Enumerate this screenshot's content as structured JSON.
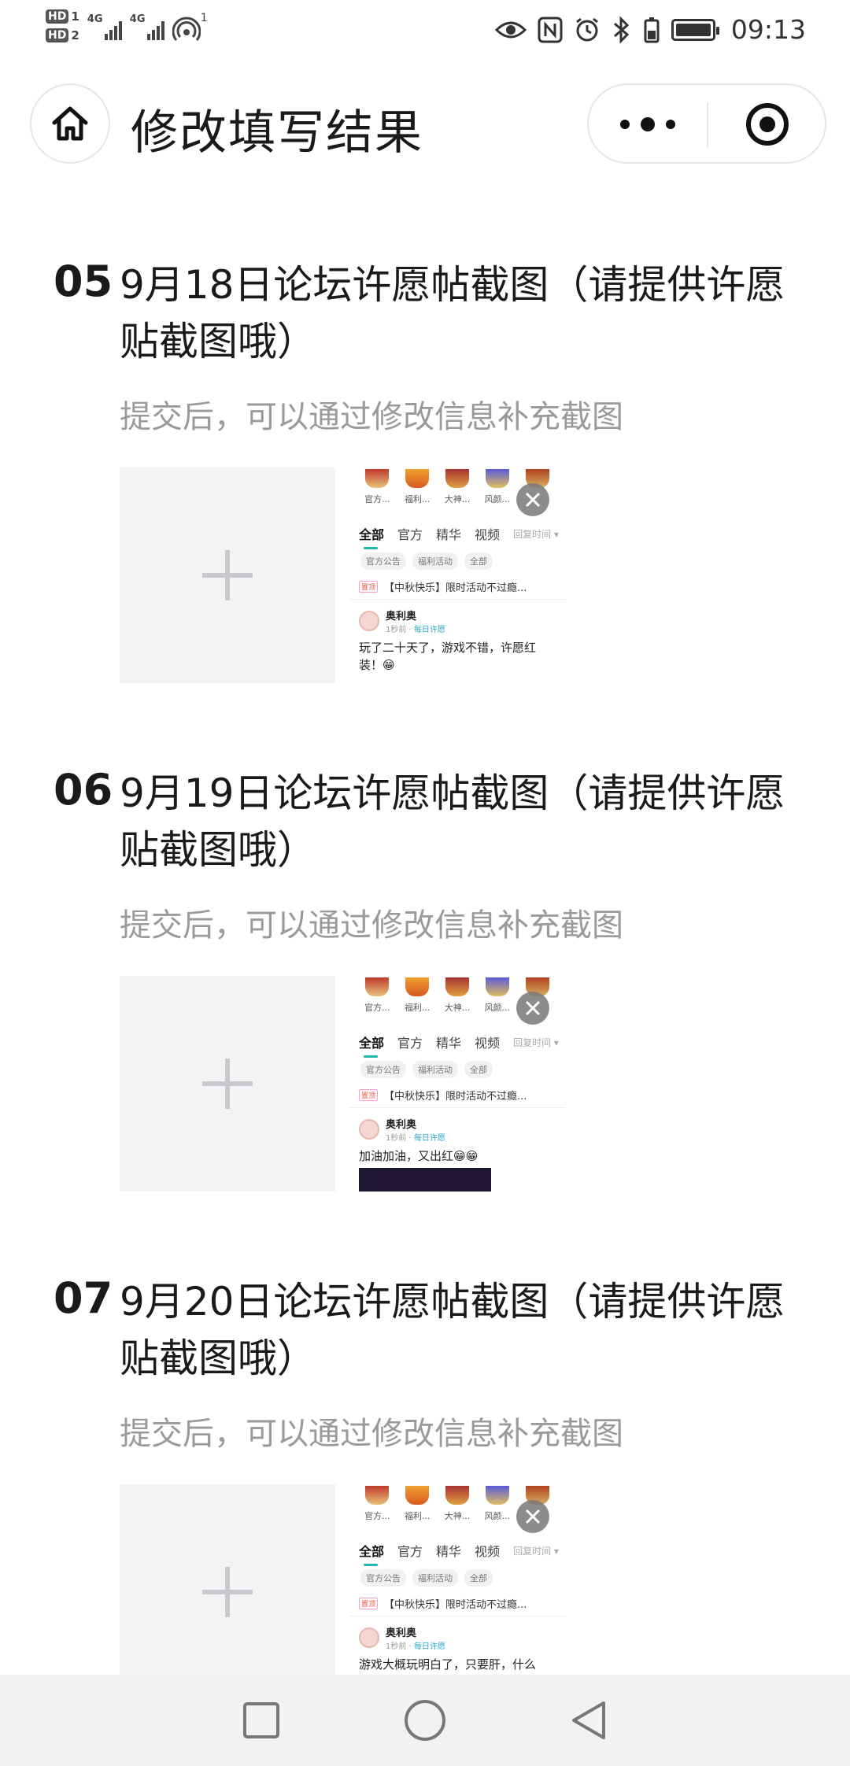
{
  "status_bar": {
    "sim1": "HD",
    "sim1_num": "1",
    "sim2": "HD",
    "sim2_num": "2",
    "net1": "4G",
    "net2": "4G",
    "hotspot_count": "1",
    "time": "09:13",
    "icons": [
      "eye-icon",
      "nfc-icon",
      "alarm-icon",
      "bluetooth-icon",
      "vibrate-battery-icon",
      "battery-icon"
    ]
  },
  "nav": {
    "title": "修改填写结果",
    "home_icon": "home-icon",
    "more_icon": "more-icon",
    "close_icon": "target-icon"
  },
  "questions": [
    {
      "number": "05",
      "title": "9月18日论坛许愿帖截图（请提供许愿贴截图哦）",
      "hint": "提交后，可以通过修改信息补充截图",
      "post_text": "玩了二十天了，游戏不错，许愿红装！😁",
      "has_dark_image": false
    },
    {
      "number": "06",
      "title": "9月19日论坛许愿帖截图（请提供许愿贴截图哦）",
      "hint": "提交后，可以通过修改信息补充截图",
      "post_text": "加油加油，又出红😁😁",
      "has_dark_image": true
    },
    {
      "number": "07",
      "title": "9月20日论坛许愿帖截图（请提供许愿贴截图哦）",
      "hint": "提交后，可以通过修改信息补充截图",
      "post_text": "游戏大概玩明白了，只要肝，什么",
      "has_dark_image": false
    }
  ],
  "thumb": {
    "icon_labels": [
      "官方...",
      "福利...",
      "大神...",
      "风颜...",
      ""
    ],
    "tabs": [
      "全部",
      "官方",
      "精华",
      "视频"
    ],
    "sort_label": "回复时间 ▾",
    "chips": [
      "官方公告",
      "福利活动",
      "全部"
    ],
    "pin_tag": "置顶",
    "pin_text": "【中秋快乐】限时活动不过瘾...",
    "username": "奥利奥",
    "meta_time": "1秒前 ·",
    "meta_tag": "每日许愿"
  },
  "colors": {
    "accent": "#1fb5b0",
    "hint_text": "#9a9a9a",
    "uploader_bg": "#f2f3f5",
    "sys_nav_bg": "#f2f2f2"
  },
  "sys_nav": {
    "icons": [
      "recents-square-icon",
      "home-circle-icon",
      "back-triangle-icon"
    ]
  }
}
